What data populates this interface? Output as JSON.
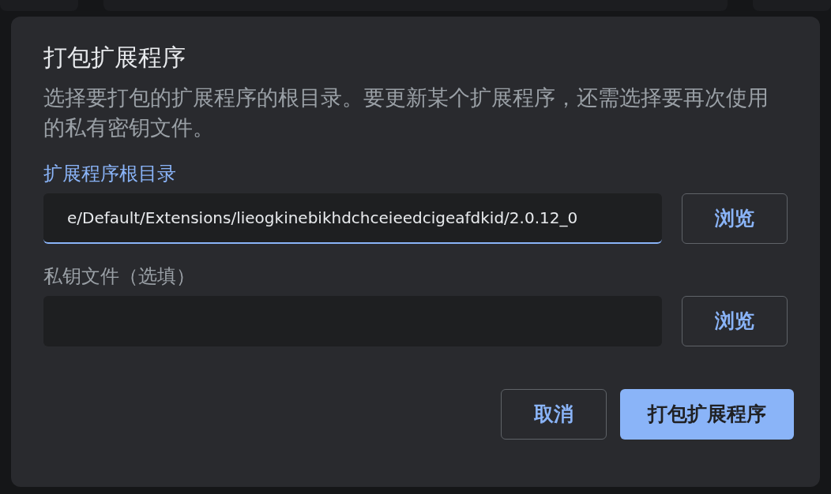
{
  "dialog": {
    "title": "打包扩展程序",
    "description": "选择要打包的扩展程序的根目录。要更新某个扩展程序，还需选择要再次使用的私有密钥文件。",
    "fields": [
      {
        "label": "扩展程序根目录",
        "value": "e/Default/Extensions/lieogkinebikhdchceieedcigeafdkid/2.0.12_0",
        "focused": true,
        "browse": "浏览"
      },
      {
        "label": "私钥文件（选填）",
        "focused": false,
        "browse": "浏览"
      }
    ],
    "buttons": [
      {
        "label": "取消",
        "kind": "secondary"
      },
      {
        "label": "打包扩展程序",
        "kind": "primary"
      }
    ]
  }
}
